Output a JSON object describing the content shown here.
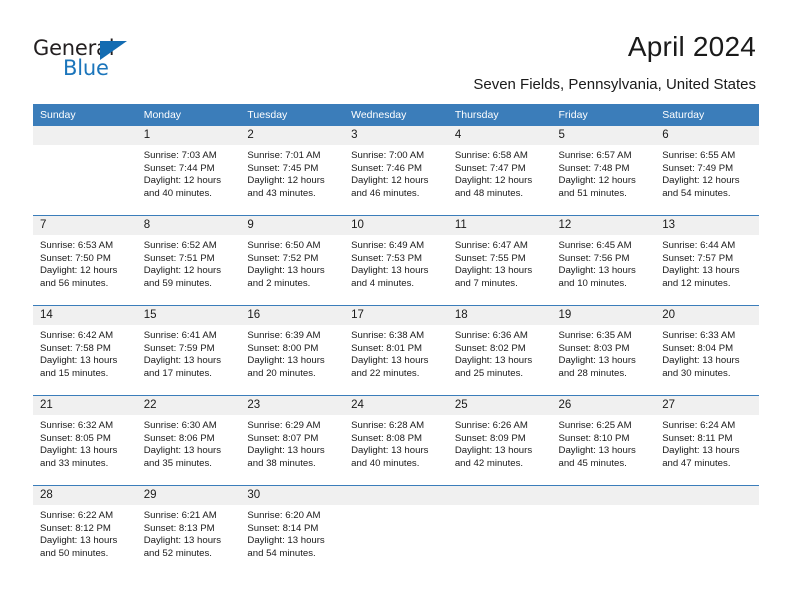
{
  "logo": {
    "word1": "General",
    "word2": "Blue",
    "triangle_color": "#136cb2",
    "blue_color": "#1b75bb"
  },
  "header": {
    "title": "April 2024",
    "subtitle": "Seven Fields, Pennsylvania, United States",
    "accent_color": "#3b7dba",
    "daynum_band_color": "#f0f0f0"
  },
  "weekday_headers": [
    "Sunday",
    "Monday",
    "Tuesday",
    "Wednesday",
    "Thursday",
    "Friday",
    "Saturday"
  ],
  "weeks": [
    [
      {
        "day": "",
        "sunrise": "",
        "sunset": "",
        "daylight1": "",
        "daylight2": ""
      },
      {
        "day": "1",
        "sunrise": "Sunrise: 7:03 AM",
        "sunset": "Sunset: 7:44 PM",
        "daylight1": "Daylight: 12 hours",
        "daylight2": "and 40 minutes."
      },
      {
        "day": "2",
        "sunrise": "Sunrise: 7:01 AM",
        "sunset": "Sunset: 7:45 PM",
        "daylight1": "Daylight: 12 hours",
        "daylight2": "and 43 minutes."
      },
      {
        "day": "3",
        "sunrise": "Sunrise: 7:00 AM",
        "sunset": "Sunset: 7:46 PM",
        "daylight1": "Daylight: 12 hours",
        "daylight2": "and 46 minutes."
      },
      {
        "day": "4",
        "sunrise": "Sunrise: 6:58 AM",
        "sunset": "Sunset: 7:47 PM",
        "daylight1": "Daylight: 12 hours",
        "daylight2": "and 48 minutes."
      },
      {
        "day": "5",
        "sunrise": "Sunrise: 6:57 AM",
        "sunset": "Sunset: 7:48 PM",
        "daylight1": "Daylight: 12 hours",
        "daylight2": "and 51 minutes."
      },
      {
        "day": "6",
        "sunrise": "Sunrise: 6:55 AM",
        "sunset": "Sunset: 7:49 PM",
        "daylight1": "Daylight: 12 hours",
        "daylight2": "and 54 minutes."
      }
    ],
    [
      {
        "day": "7",
        "sunrise": "Sunrise: 6:53 AM",
        "sunset": "Sunset: 7:50 PM",
        "daylight1": "Daylight: 12 hours",
        "daylight2": "and 56 minutes."
      },
      {
        "day": "8",
        "sunrise": "Sunrise: 6:52 AM",
        "sunset": "Sunset: 7:51 PM",
        "daylight1": "Daylight: 12 hours",
        "daylight2": "and 59 minutes."
      },
      {
        "day": "9",
        "sunrise": "Sunrise: 6:50 AM",
        "sunset": "Sunset: 7:52 PM",
        "daylight1": "Daylight: 13 hours",
        "daylight2": "and 2 minutes."
      },
      {
        "day": "10",
        "sunrise": "Sunrise: 6:49 AM",
        "sunset": "Sunset: 7:53 PM",
        "daylight1": "Daylight: 13 hours",
        "daylight2": "and 4 minutes."
      },
      {
        "day": "11",
        "sunrise": "Sunrise: 6:47 AM",
        "sunset": "Sunset: 7:55 PM",
        "daylight1": "Daylight: 13 hours",
        "daylight2": "and 7 minutes."
      },
      {
        "day": "12",
        "sunrise": "Sunrise: 6:45 AM",
        "sunset": "Sunset: 7:56 PM",
        "daylight1": "Daylight: 13 hours",
        "daylight2": "and 10 minutes."
      },
      {
        "day": "13",
        "sunrise": "Sunrise: 6:44 AM",
        "sunset": "Sunset: 7:57 PM",
        "daylight1": "Daylight: 13 hours",
        "daylight2": "and 12 minutes."
      }
    ],
    [
      {
        "day": "14",
        "sunrise": "Sunrise: 6:42 AM",
        "sunset": "Sunset: 7:58 PM",
        "daylight1": "Daylight: 13 hours",
        "daylight2": "and 15 minutes."
      },
      {
        "day": "15",
        "sunrise": "Sunrise: 6:41 AM",
        "sunset": "Sunset: 7:59 PM",
        "daylight1": "Daylight: 13 hours",
        "daylight2": "and 17 minutes."
      },
      {
        "day": "16",
        "sunrise": "Sunrise: 6:39 AM",
        "sunset": "Sunset: 8:00 PM",
        "daylight1": "Daylight: 13 hours",
        "daylight2": "and 20 minutes."
      },
      {
        "day": "17",
        "sunrise": "Sunrise: 6:38 AM",
        "sunset": "Sunset: 8:01 PM",
        "daylight1": "Daylight: 13 hours",
        "daylight2": "and 22 minutes."
      },
      {
        "day": "18",
        "sunrise": "Sunrise: 6:36 AM",
        "sunset": "Sunset: 8:02 PM",
        "daylight1": "Daylight: 13 hours",
        "daylight2": "and 25 minutes."
      },
      {
        "day": "19",
        "sunrise": "Sunrise: 6:35 AM",
        "sunset": "Sunset: 8:03 PM",
        "daylight1": "Daylight: 13 hours",
        "daylight2": "and 28 minutes."
      },
      {
        "day": "20",
        "sunrise": "Sunrise: 6:33 AM",
        "sunset": "Sunset: 8:04 PM",
        "daylight1": "Daylight: 13 hours",
        "daylight2": "and 30 minutes."
      }
    ],
    [
      {
        "day": "21",
        "sunrise": "Sunrise: 6:32 AM",
        "sunset": "Sunset: 8:05 PM",
        "daylight1": "Daylight: 13 hours",
        "daylight2": "and 33 minutes."
      },
      {
        "day": "22",
        "sunrise": "Sunrise: 6:30 AM",
        "sunset": "Sunset: 8:06 PM",
        "daylight1": "Daylight: 13 hours",
        "daylight2": "and 35 minutes."
      },
      {
        "day": "23",
        "sunrise": "Sunrise: 6:29 AM",
        "sunset": "Sunset: 8:07 PM",
        "daylight1": "Daylight: 13 hours",
        "daylight2": "and 38 minutes."
      },
      {
        "day": "24",
        "sunrise": "Sunrise: 6:28 AM",
        "sunset": "Sunset: 8:08 PM",
        "daylight1": "Daylight: 13 hours",
        "daylight2": "and 40 minutes."
      },
      {
        "day": "25",
        "sunrise": "Sunrise: 6:26 AM",
        "sunset": "Sunset: 8:09 PM",
        "daylight1": "Daylight: 13 hours",
        "daylight2": "and 42 minutes."
      },
      {
        "day": "26",
        "sunrise": "Sunrise: 6:25 AM",
        "sunset": "Sunset: 8:10 PM",
        "daylight1": "Daylight: 13 hours",
        "daylight2": "and 45 minutes."
      },
      {
        "day": "27",
        "sunrise": "Sunrise: 6:24 AM",
        "sunset": "Sunset: 8:11 PM",
        "daylight1": "Daylight: 13 hours",
        "daylight2": "and 47 minutes."
      }
    ],
    [
      {
        "day": "28",
        "sunrise": "Sunrise: 6:22 AM",
        "sunset": "Sunset: 8:12 PM",
        "daylight1": "Daylight: 13 hours",
        "daylight2": "and 50 minutes."
      },
      {
        "day": "29",
        "sunrise": "Sunrise: 6:21 AM",
        "sunset": "Sunset: 8:13 PM",
        "daylight1": "Daylight: 13 hours",
        "daylight2": "and 52 minutes."
      },
      {
        "day": "30",
        "sunrise": "Sunrise: 6:20 AM",
        "sunset": "Sunset: 8:14 PM",
        "daylight1": "Daylight: 13 hours",
        "daylight2": "and 54 minutes."
      },
      {
        "day": "",
        "sunrise": "",
        "sunset": "",
        "daylight1": "",
        "daylight2": ""
      },
      {
        "day": "",
        "sunrise": "",
        "sunset": "",
        "daylight1": "",
        "daylight2": ""
      },
      {
        "day": "",
        "sunrise": "",
        "sunset": "",
        "daylight1": "",
        "daylight2": ""
      },
      {
        "day": "",
        "sunrise": "",
        "sunset": "",
        "daylight1": "",
        "daylight2": ""
      }
    ]
  ]
}
